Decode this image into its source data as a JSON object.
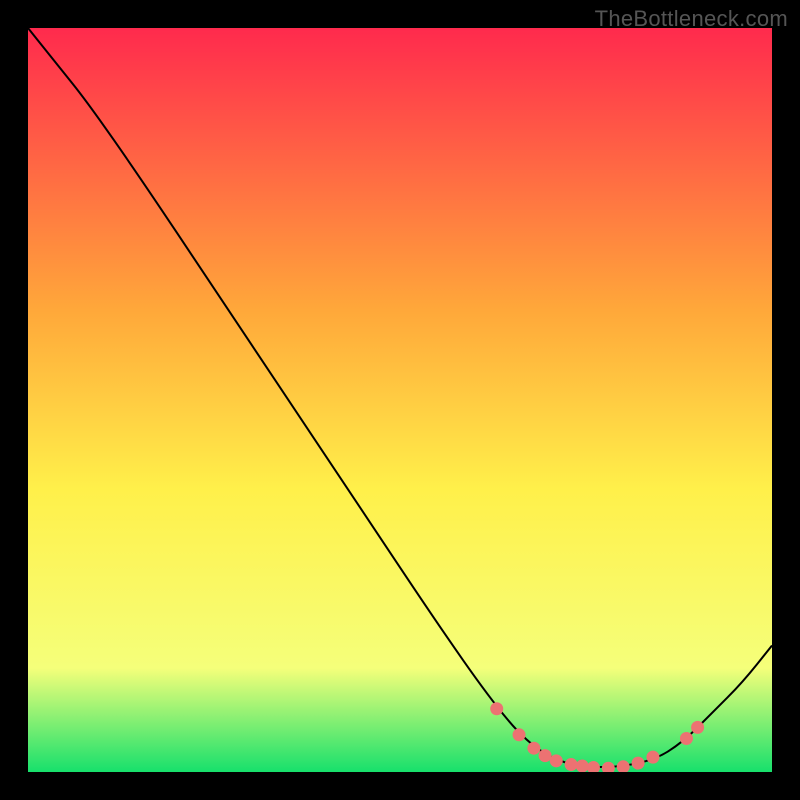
{
  "watermark": "TheBottleneck.com",
  "colors": {
    "background": "#000000",
    "gradient_top": "#ff2a4d",
    "gradient_mid1": "#ffa83a",
    "gradient_mid2": "#fff04a",
    "gradient_mid3": "#f5ff7a",
    "gradient_bottom": "#17e06c",
    "curve": "#000000",
    "dot": "#ec7272"
  },
  "chart_data": {
    "type": "line",
    "title": "",
    "xlabel": "",
    "ylabel": "",
    "x_range": [
      0,
      100
    ],
    "y_range": [
      0,
      100
    ],
    "curve": [
      {
        "x": 0,
        "y": 100
      },
      {
        "x": 4,
        "y": 95
      },
      {
        "x": 8,
        "y": 90
      },
      {
        "x": 15,
        "y": 80
      },
      {
        "x": 25,
        "y": 65
      },
      {
        "x": 35,
        "y": 50
      },
      {
        "x": 45,
        "y": 35
      },
      {
        "x": 55,
        "y": 20
      },
      {
        "x": 62,
        "y": 10
      },
      {
        "x": 67,
        "y": 4
      },
      {
        "x": 72,
        "y": 1
      },
      {
        "x": 78,
        "y": 0.5
      },
      {
        "x": 84,
        "y": 1.5
      },
      {
        "x": 88,
        "y": 4
      },
      {
        "x": 92,
        "y": 8
      },
      {
        "x": 96,
        "y": 12
      },
      {
        "x": 100,
        "y": 17
      }
    ],
    "markers": [
      {
        "x": 63,
        "y": 8.5
      },
      {
        "x": 66,
        "y": 5
      },
      {
        "x": 68,
        "y": 3.2
      },
      {
        "x": 69.5,
        "y": 2.2
      },
      {
        "x": 71,
        "y": 1.5
      },
      {
        "x": 73,
        "y": 1.0
      },
      {
        "x": 74.5,
        "y": 0.8
      },
      {
        "x": 76,
        "y": 0.6
      },
      {
        "x": 78,
        "y": 0.5
      },
      {
        "x": 80,
        "y": 0.7
      },
      {
        "x": 82,
        "y": 1.2
      },
      {
        "x": 84,
        "y": 2.0
      },
      {
        "x": 88.5,
        "y": 4.5
      },
      {
        "x": 90,
        "y": 6.0
      }
    ]
  }
}
